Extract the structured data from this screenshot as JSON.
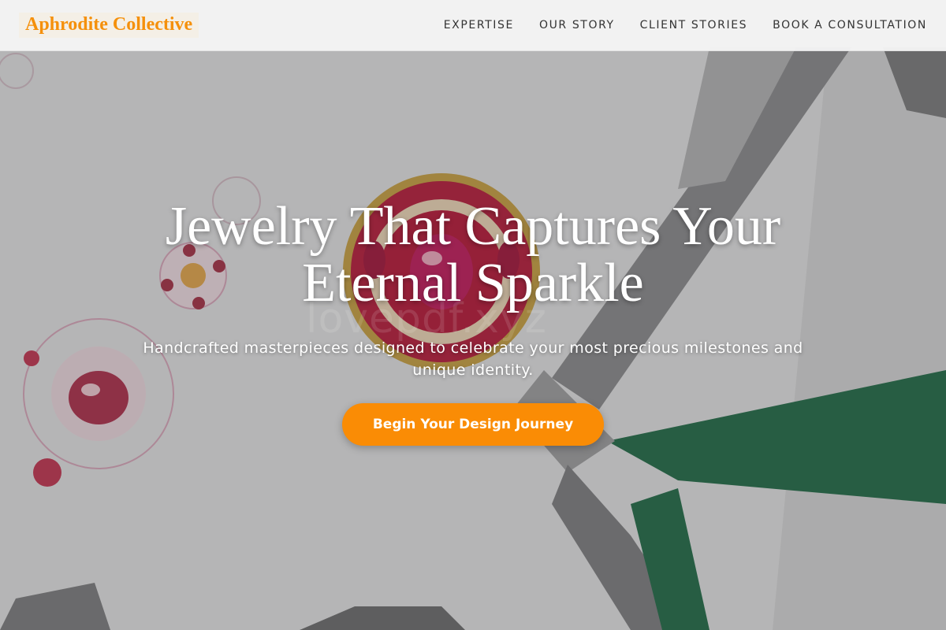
{
  "navbar": {
    "brand": "Aphrodite Collective",
    "links": [
      {
        "label": "EXPERTISE"
      },
      {
        "label": "OUR STORY"
      },
      {
        "label": "CLIENT STORIES"
      },
      {
        "label": "BOOK A CONSULTATION"
      }
    ]
  },
  "hero": {
    "title": "Jewelry That Captures Your Eternal Sparkle",
    "subtitle": "Handcrafted masterpieces designed to celebrate your most precious milestones and unique identity.",
    "cta_label": "Begin Your Design Journey",
    "watermark": "lovepdf.xyz"
  },
  "colors": {
    "brand": "#f5900b",
    "cta": "#fa8c05",
    "nav_text": "#333333",
    "hero_text": "#ffffff"
  }
}
